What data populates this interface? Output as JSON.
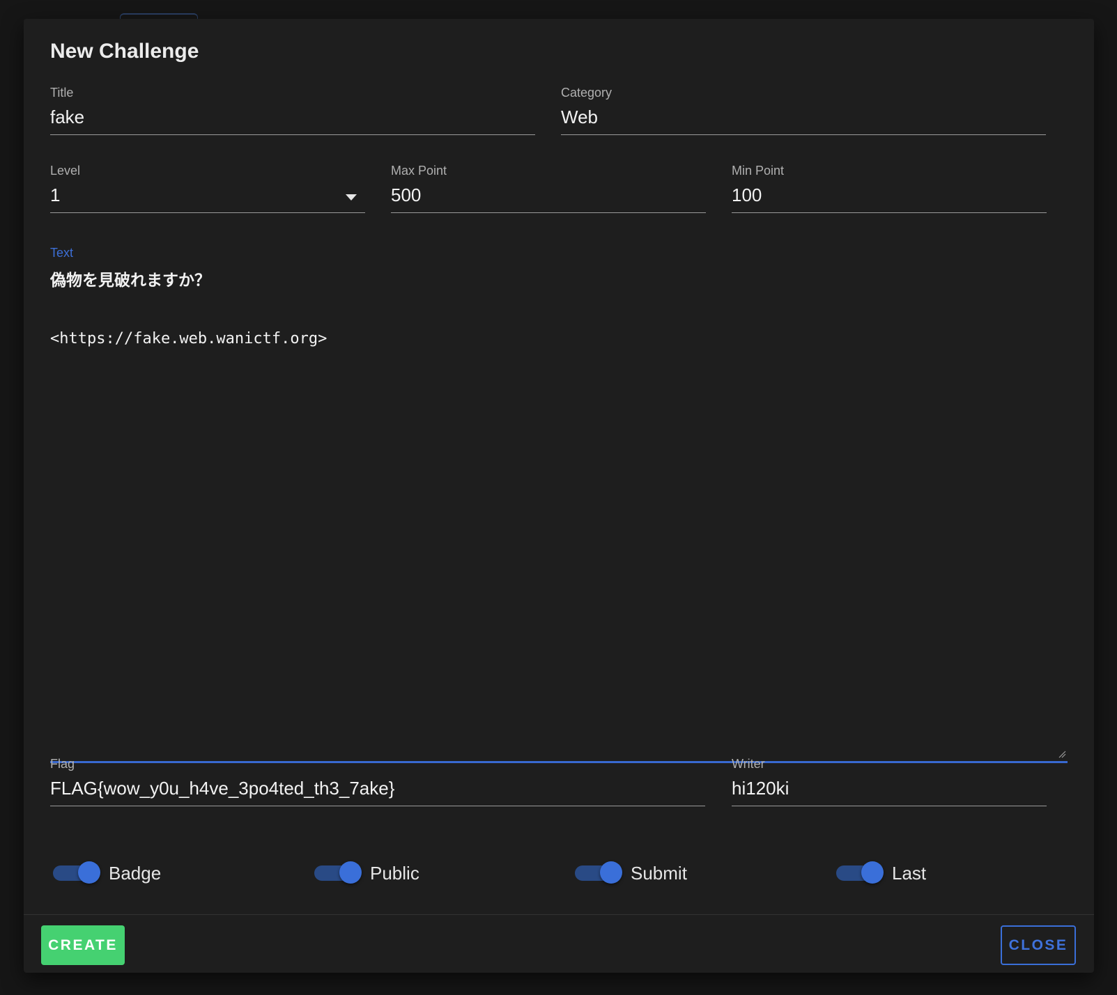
{
  "dialog": {
    "title": "New Challenge"
  },
  "fields": {
    "title": {
      "label": "Title",
      "value": "fake"
    },
    "category": {
      "label": "Category",
      "value": "Web"
    },
    "level": {
      "label": "Level",
      "value": "1"
    },
    "max_point": {
      "label": "Max Point",
      "value": "500"
    },
    "min_point": {
      "label": "Min Point",
      "value": "100"
    },
    "text": {
      "label": "Text",
      "line1": "偽物を見破れますか？",
      "line2": "<https://fake.web.wanictf.org>"
    },
    "flag": {
      "label": "Flag",
      "value": "FLAG{wow_y0u_h4ve_3po4ted_th3_7ake}"
    },
    "writer": {
      "label": "Writer",
      "value": "hi120ki"
    }
  },
  "switches": [
    {
      "label": "Badge",
      "on": true
    },
    {
      "label": "Public",
      "on": true
    },
    {
      "label": "Submit",
      "on": true
    },
    {
      "label": "Last",
      "on": true
    }
  ],
  "actions": {
    "create_label": "CREATE",
    "close_label": "CLOSE"
  },
  "colors": {
    "accent": "#3a6fd9",
    "create": "#45d171",
    "dialog_bg": "#1e1e1e"
  },
  "icons": {
    "level_dropdown": "caret-down-icon",
    "textarea_resize": "resize-handle-icon"
  }
}
